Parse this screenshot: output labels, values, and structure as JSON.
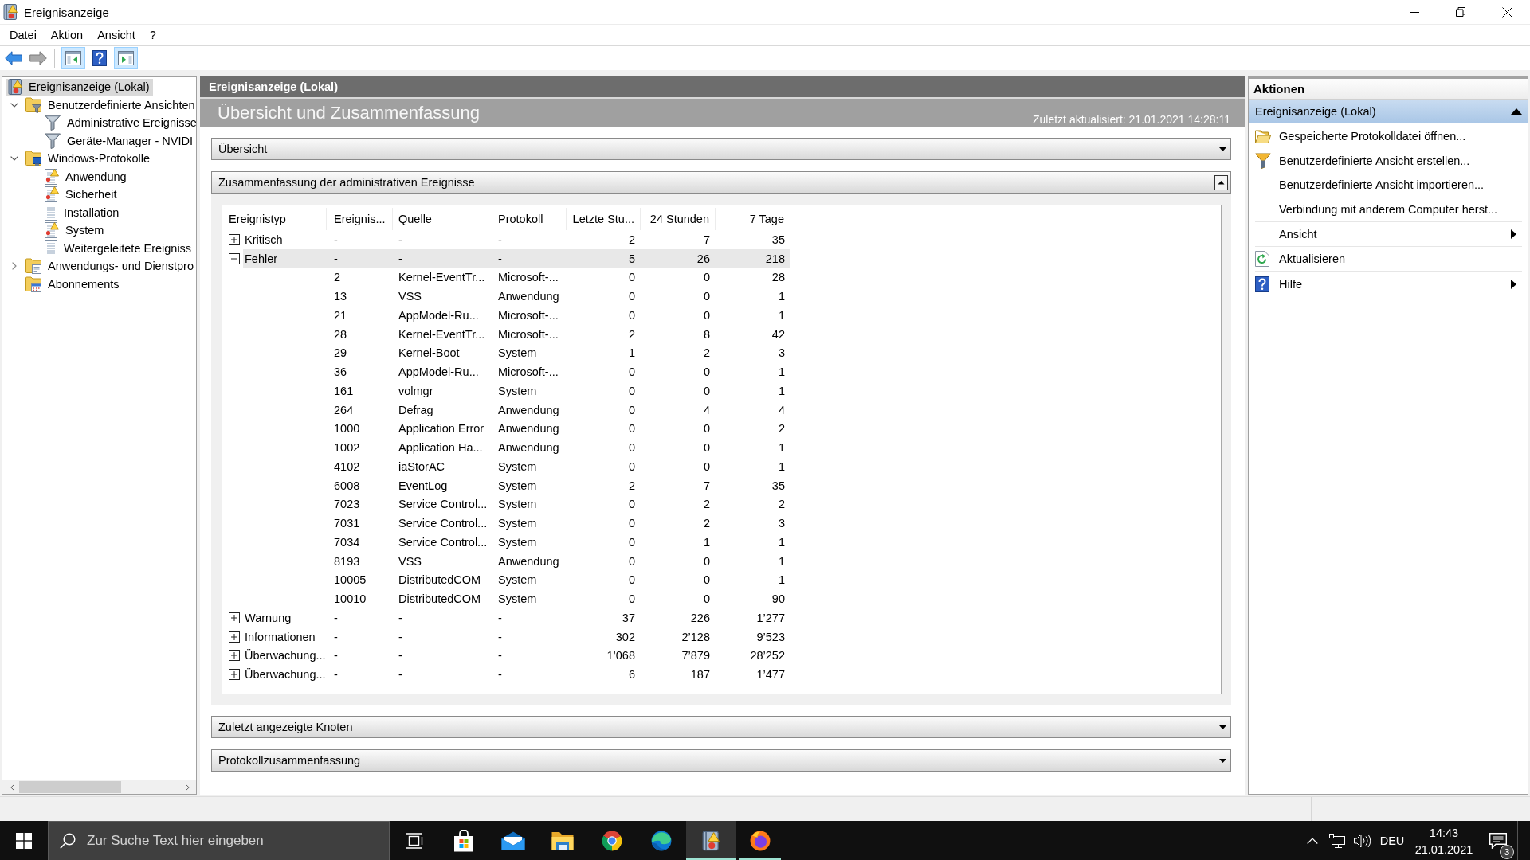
{
  "window": {
    "title": "Ereignisanzeige"
  },
  "menu": [
    "Datei",
    "Aktion",
    "Ansicht",
    "?"
  ],
  "toolbar": [
    {
      "kind": "back",
      "disabled": false
    },
    {
      "kind": "forward",
      "disabled": true
    },
    {
      "kind": "treepane",
      "on": true
    },
    {
      "kind": "help",
      "on": false
    },
    {
      "kind": "actionpane",
      "on": true
    }
  ],
  "tree": [
    {
      "label": "Ereignisanzeige (Lokal)",
      "kind": "root",
      "selected": true,
      "children": [
        {
          "label": "Benutzerdefinierte Ansichten",
          "kind": "viewfolder",
          "selected": false,
          "expanded": true,
          "children": [
            {
              "label": "Administrative Ereignisse",
              "kind": "view",
              "selected": false
            },
            {
              "label": "Geräte-Manager - NVIDI",
              "kind": "view",
              "selected": false
            }
          ]
        },
        {
          "label": "Windows-Protokolle",
          "kind": "logfolder",
          "selected": false,
          "expanded": true,
          "children": [
            {
              "label": "Anwendung",
              "kind": "log",
              "selected": false
            },
            {
              "label": "Sicherheit",
              "kind": "log",
              "selected": false
            },
            {
              "label": "Installation",
              "kind": "plainlog",
              "selected": false
            },
            {
              "label": "System",
              "kind": "log",
              "selected": false
            },
            {
              "label": "Weitergeleitete Ereigniss",
              "kind": "plainlog",
              "selected": false
            }
          ]
        },
        {
          "label": "Anwendungs- und Dienstpro",
          "kind": "appfolder",
          "selected": false,
          "expanded": false
        },
        {
          "label": "Abonnements",
          "kind": "subscriptions",
          "selected": false
        }
      ]
    }
  ],
  "main": {
    "header": "Ereignisanzeige (Lokal)",
    "title": "Übersicht und Zusammenfassung",
    "updated": "Zuletzt aktualisiert: 21.01.2021 14:28:11",
    "sections": [
      {
        "title": "Übersicht",
        "expanded": false
      },
      {
        "title": "Zusammenfassung der administrativen Ereignisse",
        "expanded": true,
        "table": {
          "columns": [
            "Ereignistyp",
            "Ereignis...",
            "Quelle",
            "Protokoll",
            "Letzte Stu...",
            "24 Stunden",
            "7 Tage"
          ],
          "rows": [
            {
              "expanded": false,
              "selected": false,
              "cells": [
                "Kritisch",
                "-",
                "-",
                "-",
                "2",
                "7",
                "35"
              ]
            },
            {
              "expanded": true,
              "selected": true,
              "cells": [
                "Fehler",
                "-",
                "-",
                "-",
                "5",
                "26",
                "218"
              ],
              "children": [
                {
                  "selected": false,
                  "cells": [
                    "",
                    "2",
                    "Kernel-EventTr...",
                    "Microsoft-...",
                    "0",
                    "0",
                    "28"
                  ]
                },
                {
                  "selected": false,
                  "cells": [
                    "",
                    "13",
                    "VSS",
                    "Anwendung",
                    "0",
                    "0",
                    "1"
                  ]
                },
                {
                  "selected": false,
                  "cells": [
                    "",
                    "21",
                    "AppModel-Ru...",
                    "Microsoft-...",
                    "0",
                    "0",
                    "1"
                  ]
                },
                {
                  "selected": false,
                  "cells": [
                    "",
                    "28",
                    "Kernel-EventTr...",
                    "Microsoft-...",
                    "2",
                    "8",
                    "42"
                  ]
                },
                {
                  "selected": false,
                  "cells": [
                    "",
                    "29",
                    "Kernel-Boot",
                    "System",
                    "1",
                    "2",
                    "3"
                  ]
                },
                {
                  "selected": false,
                  "cells": [
                    "",
                    "36",
                    "AppModel-Ru...",
                    "Microsoft-...",
                    "0",
                    "0",
                    "1"
                  ]
                },
                {
                  "selected": false,
                  "cells": [
                    "",
                    "161",
                    "volmgr",
                    "System",
                    "0",
                    "0",
                    "1"
                  ]
                },
                {
                  "selected": false,
                  "cells": [
                    "",
                    "264",
                    "Defrag",
                    "Anwendung",
                    "0",
                    "4",
                    "4"
                  ]
                },
                {
                  "selected": false,
                  "cells": [
                    "",
                    "1000",
                    "Application Error",
                    "Anwendung",
                    "0",
                    "0",
                    "2"
                  ]
                },
                {
                  "selected": false,
                  "cells": [
                    "",
                    "1002",
                    "Application Ha...",
                    "Anwendung",
                    "0",
                    "0",
                    "1"
                  ]
                },
                {
                  "selected": false,
                  "cells": [
                    "",
                    "4102",
                    "iaStorAC",
                    "System",
                    "0",
                    "0",
                    "1"
                  ]
                },
                {
                  "selected": false,
                  "cells": [
                    "",
                    "6008",
                    "EventLog",
                    "System",
                    "2",
                    "7",
                    "35"
                  ]
                },
                {
                  "selected": false,
                  "cells": [
                    "",
                    "7023",
                    "Service Control...",
                    "System",
                    "0",
                    "2",
                    "2"
                  ]
                },
                {
                  "selected": false,
                  "cells": [
                    "",
                    "7031",
                    "Service Control...",
                    "System",
                    "0",
                    "2",
                    "3"
                  ]
                },
                {
                  "selected": false,
                  "cells": [
                    "",
                    "7034",
                    "Service Control...",
                    "System",
                    "0",
                    "1",
                    "1"
                  ]
                },
                {
                  "selected": false,
                  "cells": [
                    "",
                    "8193",
                    "VSS",
                    "Anwendung",
                    "0",
                    "0",
                    "1"
                  ]
                },
                {
                  "selected": false,
                  "cells": [
                    "",
                    "10005",
                    "DistributedCOM",
                    "System",
                    "0",
                    "0",
                    "1"
                  ]
                },
                {
                  "selected": false,
                  "cells": [
                    "",
                    "10010",
                    "DistributedCOM",
                    "System",
                    "0",
                    "0",
                    "90"
                  ]
                }
              ]
            },
            {
              "expanded": false,
              "selected": false,
              "cells": [
                "Warnung",
                "-",
                "-",
                "-",
                "37",
                "226",
                "1’277"
              ]
            },
            {
              "expanded": false,
              "selected": false,
              "cells": [
                "Informationen",
                "-",
                "-",
                "-",
                "302",
                "2’128",
                "9’523"
              ]
            },
            {
              "expanded": false,
              "selected": false,
              "cells": [
                "Überwachung...",
                "-",
                "-",
                "-",
                "1’068",
                "7’879",
                "28’252"
              ]
            },
            {
              "expanded": false,
              "selected": false,
              "cells": [
                "Überwachung...",
                "-",
                "-",
                "-",
                "6",
                "187",
                "1’477"
              ]
            }
          ]
        }
      },
      {
        "title": "Zuletzt angezeigte Knoten",
        "expanded": false
      },
      {
        "title": "Protokollzusammenfassung",
        "expanded": false
      }
    ]
  },
  "actions": {
    "title": "Aktionen",
    "groups": [
      {
        "title": "Ereignisanzeige (Lokal)",
        "expanded": true,
        "items": [
          {
            "label": "Gespeicherte Protokolldatei öffnen...",
            "kind": "open",
            "submenu": false
          },
          {
            "label": "Benutzerdefinierte Ansicht erstellen...",
            "kind": "filter",
            "submenu": false
          },
          {
            "label": "Benutzerdefinierte Ansicht importieren...",
            "kind": "plain",
            "submenu": false
          },
          {
            "label": "Verbindung mit anderem Computer herst...",
            "kind": "plain",
            "submenu": false
          },
          {
            "label": "Ansicht",
            "kind": "plain",
            "submenu": true
          },
          {
            "label": "Aktualisieren",
            "kind": "refresh",
            "submenu": false
          },
          {
            "label": "Hilfe",
            "kind": "help",
            "submenu": true
          }
        ]
      }
    ]
  },
  "taskbar": {
    "search": {
      "placeholder": "Zur Suche Text hier eingeben"
    },
    "apps": [
      {
        "kind": "taskview",
        "running": false,
        "active": false
      },
      {
        "kind": "store",
        "running": false,
        "active": false
      },
      {
        "kind": "mail",
        "running": false,
        "active": false
      },
      {
        "kind": "files",
        "running": false,
        "active": false
      },
      {
        "kind": "ringbrowser",
        "running": false,
        "active": false
      },
      {
        "kind": "wavebrowser",
        "running": false,
        "active": false
      },
      {
        "kind": "eventlog",
        "running": true,
        "active": true
      },
      {
        "kind": "foxbrowser",
        "running": true,
        "active": false
      }
    ],
    "tray": {
      "language": "DEU",
      "time": "14:43",
      "date": "21.01.2021",
      "notifications": "3"
    }
  }
}
